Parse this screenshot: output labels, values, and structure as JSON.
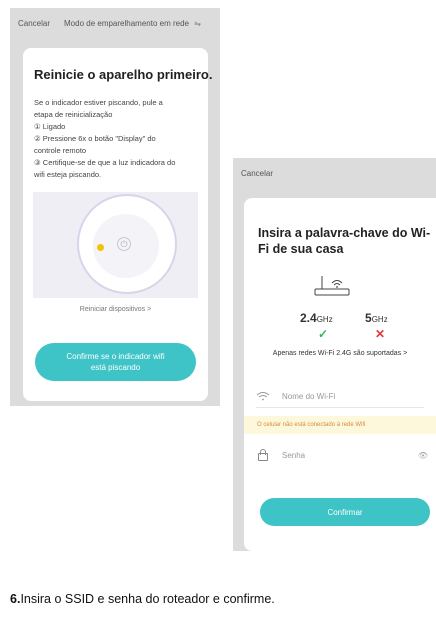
{
  "screen1": {
    "cancel_label": "Cancelar",
    "mode_label": "Modo de emparelhamento em rede",
    "mode_icon": "swap-arrows-icon",
    "title": "Reinicie o aparelho primeiro.",
    "intro_lines": [
      "Se o indicador estiver piscando, pule a",
      "etapa de reinicialização"
    ],
    "steps": [
      "① Ligado",
      "② Pressione 6x o botão \"Display\" do",
      "controle remoto",
      "③ Certifique-se de que a luz indicadora do",
      "wifi esteja piscando."
    ],
    "restart_link": "Reiniciar dispositivos  >",
    "confirm_button": "Confirme se o indicador wifi está piscando"
  },
  "screen2": {
    "cancel_label": "Cancelar",
    "title": "Insira a palavra-chave do Wi-Fi de sua casa",
    "freq_24": "2.4",
    "freq_5": "5",
    "freq_unit": "GHz",
    "supported_note": "Apenas redes Wi-Fi 2.4G são suportadas  >",
    "wifi_placeholder": "Nome do Wi-Fi",
    "warning": "O celular não está conectado à rede Wifi",
    "password_placeholder": "Senha",
    "confirm_button": "Confirmar"
  },
  "caption": {
    "number": "6.",
    "text": "Insira o SSID e senha do roteador e confirme."
  },
  "colors": {
    "accent": "#3ec3c6",
    "check": "#30b85a",
    "cross": "#e23b3b",
    "warning_bg": "#fdf7dc",
    "warning_text": "#d98a3a",
    "led": "#f2c300"
  }
}
